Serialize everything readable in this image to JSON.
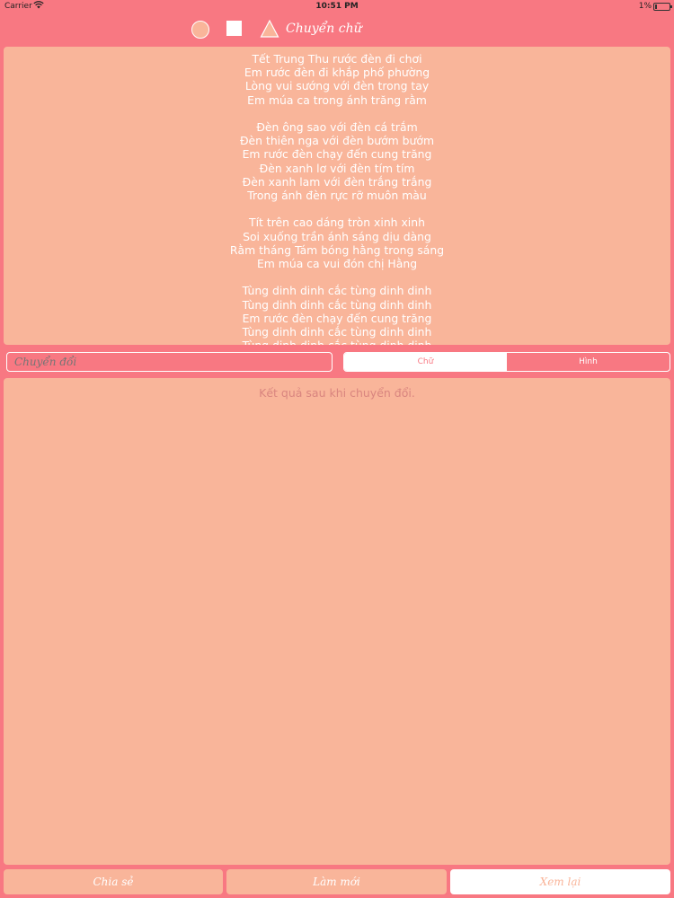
{
  "status_bar": {
    "carrier": "Carrier",
    "time": "10:51 PM",
    "battery_percent": "1%"
  },
  "toolbar": {
    "title": "Chuyển chữ",
    "shapes": [
      "circle-icon",
      "square-icon",
      "triangle-icon"
    ]
  },
  "input_text": "Tết Trung Thu rước đèn đi chơi\nEm rước đèn đi khắp phố phường\nLòng vui sướng với đèn trong tay\nEm múa ca trong ánh trăng rằm\n\nĐèn ông sao với đèn cá trắm\nĐèn thiên nga với đèn bướm bướm\nEm rước đèn chạy đến cung trăng\nĐèn xanh lơ với đèn tím tím\nĐèn xanh lam với đèn trắng trắng\nTrong ánh đèn rực rỡ muôn màu\n\nTít trên cao dáng tròn xinh xinh\nSoi xuống trần ánh sáng dịu dàng\nRằm tháng Tám bóng hằng trong sáng\nEm múa ca vui đón chị Hằng\n\nTùng dinh dinh cắc tùng dinh dinh\nTùng dinh dinh cắc tùng dinh dinh\nEm rước đèn chạy đến cung trăng\nTùng dinh dinh cắc tùng dinh dinh\nTùng dinh dinh cắc tùng dinh dinh",
  "convert_field": {
    "placeholder": "Chuyển đổi"
  },
  "segments": {
    "text": "Chữ",
    "image": "Hình",
    "selected": "Chữ"
  },
  "output": {
    "placeholder": "Kết quả sau khi chuyển đổi."
  },
  "bottom_buttons": {
    "save": "Chia sẻ",
    "reset": "Làm mới",
    "review": "Xem lại"
  },
  "colors": {
    "background": "#F87882",
    "panel": "#F9B59A",
    "white": "#FFFFFF"
  }
}
